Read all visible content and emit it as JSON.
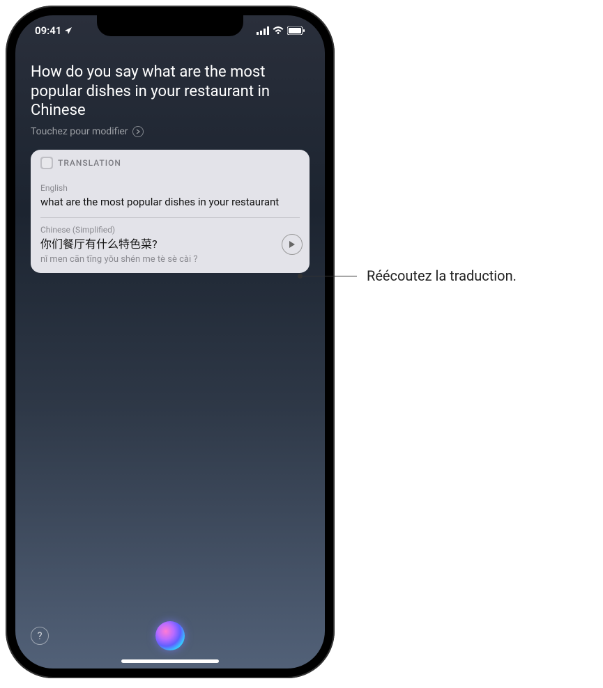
{
  "status": {
    "time": "09:41",
    "location_icon": "location-arrow-icon",
    "signal": "signal-icon",
    "wifi": "wifi-icon",
    "battery": "battery-icon"
  },
  "siri": {
    "query": "How do you say what are the most popular dishes in your restaurant in Chinese",
    "tap_to_edit": "Touchez pour modifier"
  },
  "card": {
    "header_icon": "app-icon",
    "header_label": "TRANSLATION",
    "source_lang": "English",
    "source_text": "what are the most popular dishes in your restaurant",
    "target_lang": "Chinese (Simplified)",
    "target_text": "你们餐厅有什么特色菜?",
    "target_romanization": "nǐ men cān tīng yǒu shén me tè sè cài ?"
  },
  "controls": {
    "help": "?",
    "siri_orb": "siri-orb"
  },
  "callout": {
    "text": "Réécoutez la traduction."
  }
}
